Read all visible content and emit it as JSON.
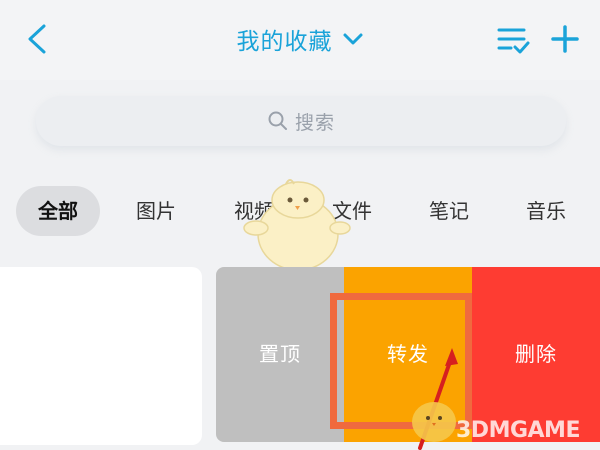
{
  "header": {
    "title": "我的收藏",
    "icons": [
      "back-icon",
      "chevron-down-icon",
      "list-check-icon",
      "plus-icon"
    ]
  },
  "search": {
    "placeholder": "搜索",
    "icon": "search-icon"
  },
  "tabs": [
    {
      "label": "全部",
      "active": true
    },
    {
      "label": "图片",
      "active": false
    },
    {
      "label": "视频",
      "active": false
    },
    {
      "label": "文件",
      "active": false
    },
    {
      "label": "笔记",
      "active": false
    },
    {
      "label": "音乐",
      "active": false
    }
  ],
  "swipe_actions": {
    "pin": "置顶",
    "forward": "转发",
    "delete": "删除"
  },
  "watermark": {
    "text": "3DMGAME"
  },
  "colors": {
    "accent": "#1aa3d9",
    "pin": "#bfbfbf",
    "forward": "#fba300",
    "delete": "#fe3c32",
    "annotation": "#f06a3e"
  }
}
